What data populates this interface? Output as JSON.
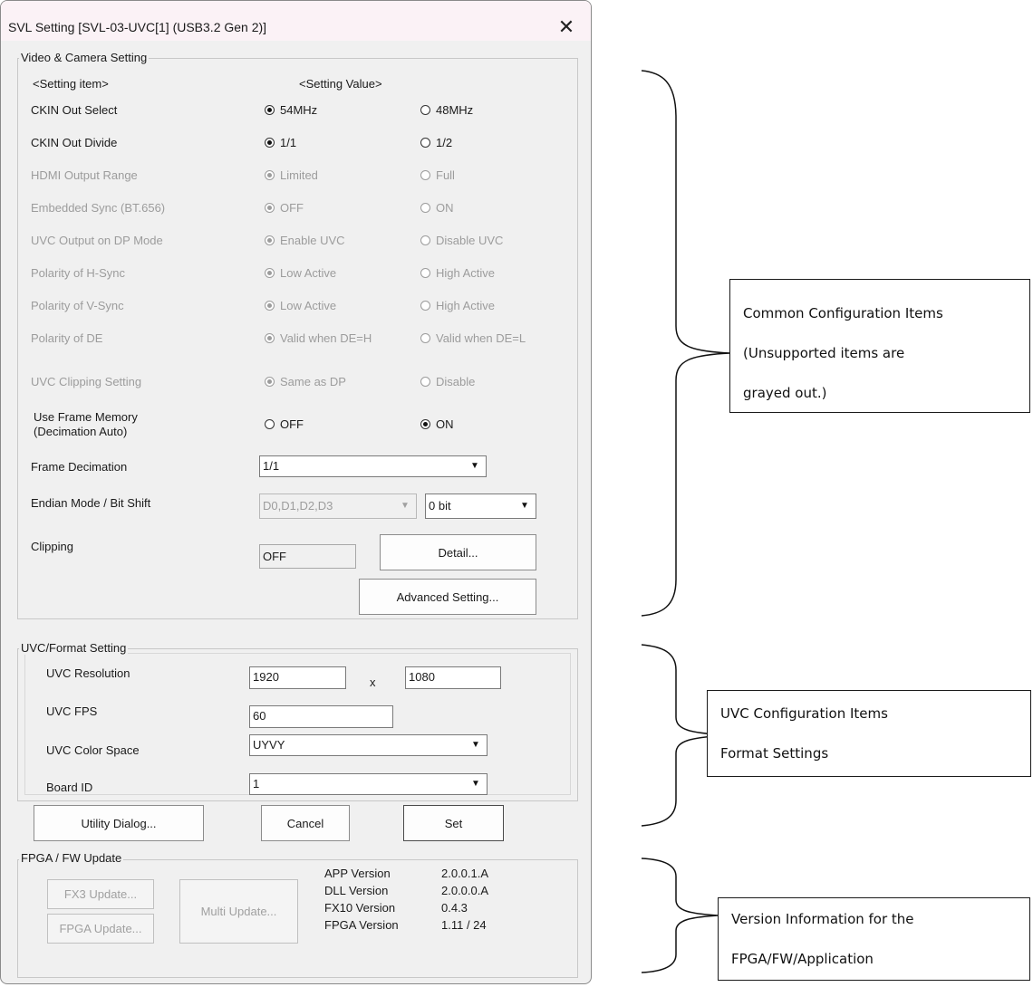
{
  "window": {
    "title": "SVL Setting [SVL-03-UVC[1] (USB3.2 Gen 2)]",
    "close_glyph": "✕"
  },
  "video_camera": {
    "group_title": "Video & Camera Setting",
    "col_item": "<Setting item>",
    "col_value": "<Setting Value>",
    "rows": [
      {
        "label": "CKIN Out Select",
        "opt1": "54MHz",
        "opt2": "48MHz"
      },
      {
        "label": "CKIN Out Divide",
        "opt1": "1/1",
        "opt2": "1/2"
      },
      {
        "label": "HDMI Output Range",
        "opt1": "Limited",
        "opt2": "Full"
      },
      {
        "label": "Embedded Sync (BT.656)",
        "opt1": "OFF",
        "opt2": "ON"
      },
      {
        "label": "UVC Output on DP Mode",
        "opt1": "Enable UVC",
        "opt2": "Disable UVC"
      },
      {
        "label": "Polarity of H-Sync",
        "opt1": "Low Active",
        "opt2": "High Active"
      },
      {
        "label": "Polarity of V-Sync",
        "opt1": "Low Active",
        "opt2": "High Active"
      },
      {
        "label": "Polarity of DE",
        "opt1": "Valid when DE=H",
        "opt2": "Valid when DE=L"
      },
      {
        "label": "UVC Clipping Setting",
        "opt1": "Same as DP",
        "opt2": "Disable"
      },
      {
        "label_line1": "Use Frame Memory",
        "label_line2": "(Decimation Auto)",
        "opt1": "OFF",
        "opt2": "ON"
      }
    ],
    "frame_decimation": {
      "label": "Frame Decimation",
      "value": "1/1"
    },
    "endian": {
      "label": "Endian Mode / Bit Shift",
      "value": "D0,D1,D2,D3",
      "bit_shift": "0 bit"
    },
    "clipping": {
      "label": "Clipping",
      "value": "OFF",
      "detail_button": "Detail..."
    },
    "advanced_button": "Advanced Setting..."
  },
  "uvc_format": {
    "group_title": "UVC/Format Setting",
    "resolution": {
      "label": "UVC Resolution",
      "width": "1920",
      "sep": "x",
      "height": "1080"
    },
    "fps": {
      "label": "UVC FPS",
      "value": "60"
    },
    "color_space": {
      "label": "UVC Color Space",
      "value": "UYVY"
    },
    "board_id": {
      "label": "Board ID",
      "value": "1"
    }
  },
  "buttons": {
    "utility": "Utility Dialog...",
    "cancel": "Cancel",
    "set": "Set"
  },
  "fpga_fw": {
    "group_title": "FPGA / FW Update",
    "fx3_update": "FX3 Update...",
    "fpga_update": "FPGA Update...",
    "multi_update": "Multi Update...",
    "versions": [
      {
        "name": "APP Version",
        "value": "2.0.0.1.A"
      },
      {
        "name": "DLL Version",
        "value": "2.0.0.0.A"
      },
      {
        "name": "FX10 Version",
        "value": "0.4.3"
      },
      {
        "name": "FPGA Version",
        "value": "1.11 / 24"
      }
    ]
  },
  "annotations": {
    "common": {
      "line1": "Common Configuration Items",
      "line2": "(Unsupported items are",
      "line3": "grayed out.)"
    },
    "uvc": {
      "line1": "UVC Configuration Items",
      "line2": "Format Settings"
    },
    "version": {
      "line1": "Version Information for the",
      "line2": "FPGA/FW/Application"
    }
  },
  "colors": {
    "title_bar": "#fbf2f6",
    "dialog_bg": "#f0f0f0",
    "disabled_text": "#9c9c9c"
  }
}
